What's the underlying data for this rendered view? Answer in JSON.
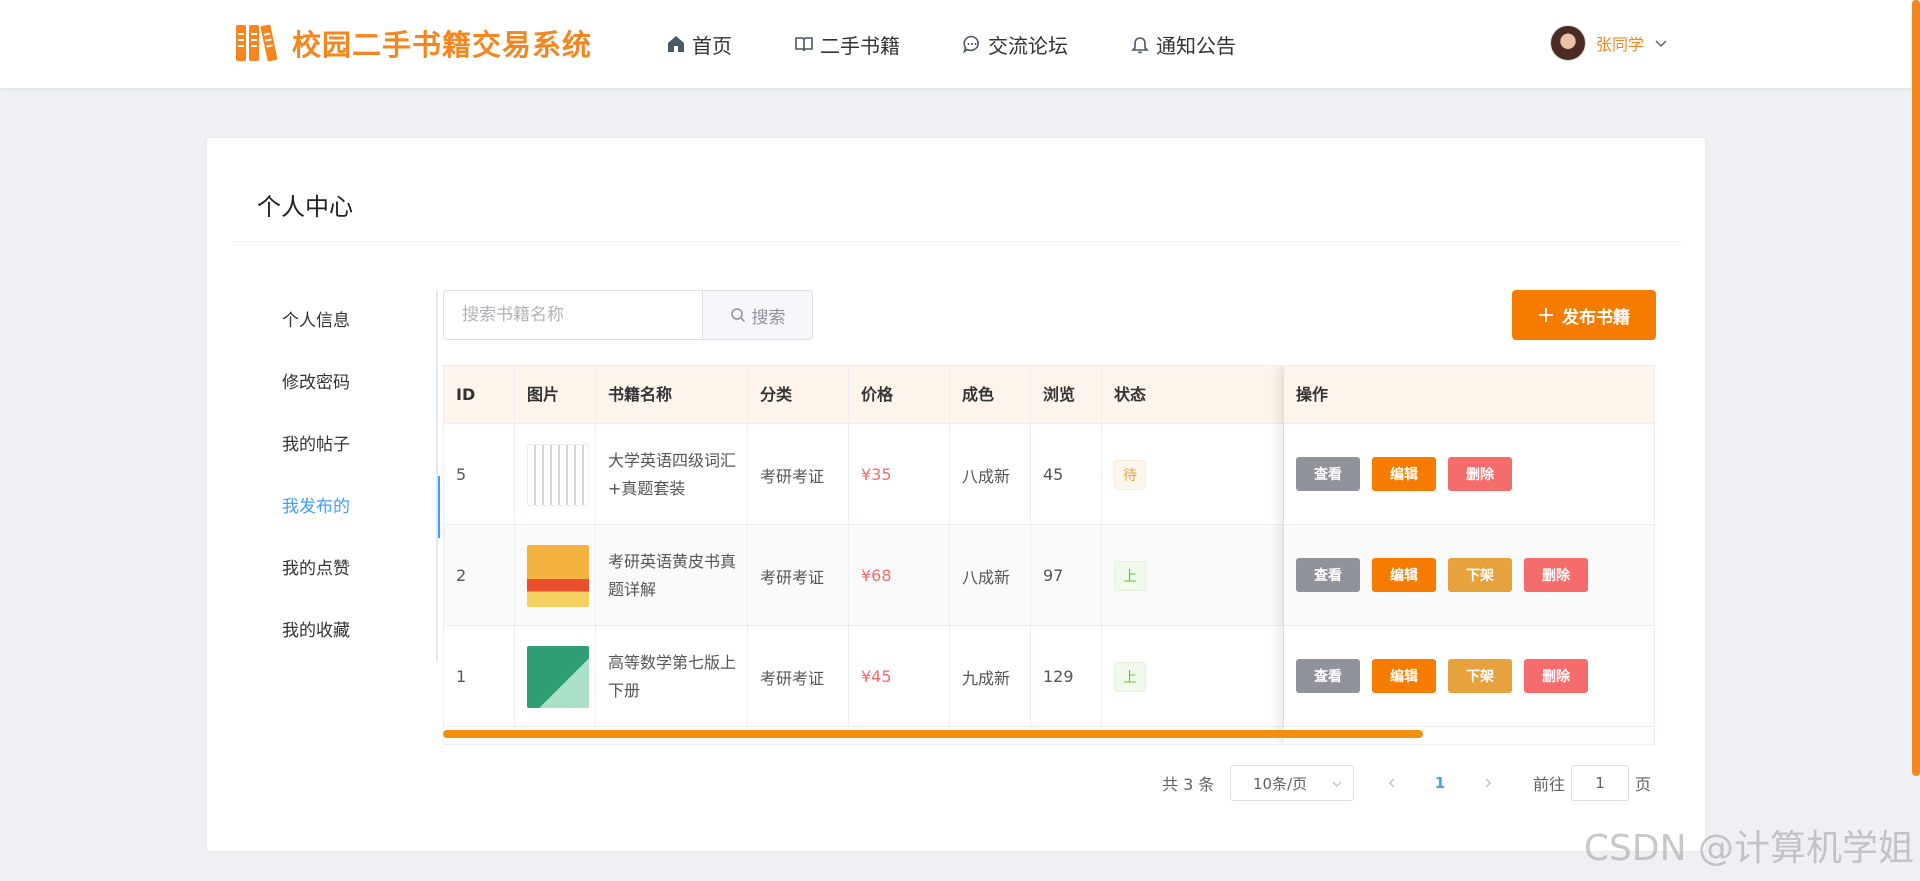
{
  "header": {
    "logo_text": "校园二手书籍交易系统",
    "nav": [
      {
        "label": "首页",
        "icon": "home-icon"
      },
      {
        "label": "二手书籍",
        "icon": "book-icon"
      },
      {
        "label": "交流论坛",
        "icon": "chat-icon"
      },
      {
        "label": "通知公告",
        "icon": "bell-icon"
      }
    ],
    "user_name": "张同学"
  },
  "page": {
    "title": "个人中心"
  },
  "side_menu": {
    "items": [
      {
        "label": "个人信息"
      },
      {
        "label": "修改密码"
      },
      {
        "label": "我的帖子"
      },
      {
        "label": "我发布的",
        "active": true
      },
      {
        "label": "我的点赞"
      },
      {
        "label": "我的收藏"
      }
    ]
  },
  "search": {
    "placeholder": "搜索书籍名称",
    "button_label": "搜索"
  },
  "publish_button": "发布书籍",
  "table": {
    "columns": [
      "ID",
      "图片",
      "书籍名称",
      "分类",
      "价格",
      "成色",
      "浏览",
      "状态",
      "操作"
    ],
    "rows": [
      {
        "id": "5",
        "name": "大学英语四级词汇+真题套装",
        "category": "考研考证",
        "price": "¥35",
        "condition": "八成新",
        "views": "45",
        "status": "待",
        "actions": [
          "查看",
          "编辑",
          "删除"
        ]
      },
      {
        "id": "2",
        "name": "考研英语黄皮书真题详解",
        "category": "考研考证",
        "price": "¥68",
        "condition": "八成新",
        "views": "97",
        "status": "上",
        "actions": [
          "查看",
          "编辑",
          "下架",
          "删除"
        ]
      },
      {
        "id": "1",
        "name": "高等数学第七版上下册",
        "category": "考研考证",
        "price": "¥45",
        "condition": "九成新",
        "views": "129",
        "status": "上",
        "actions": [
          "查看",
          "编辑",
          "下架",
          "删除"
        ]
      }
    ]
  },
  "pagination": {
    "total": "共 3 条",
    "page_size": "10条/页",
    "current_page": "1",
    "goto_prefix": "前往",
    "goto_value": "1",
    "goto_suffix": "页"
  },
  "watermark": "CSDN @计算机学姐",
  "colors": {
    "accent": "#f5861f",
    "primary": "#f57c00",
    "link": "#409eff",
    "danger": "#f56c6c",
    "warning": "#e6a23c",
    "info": "#909399"
  }
}
